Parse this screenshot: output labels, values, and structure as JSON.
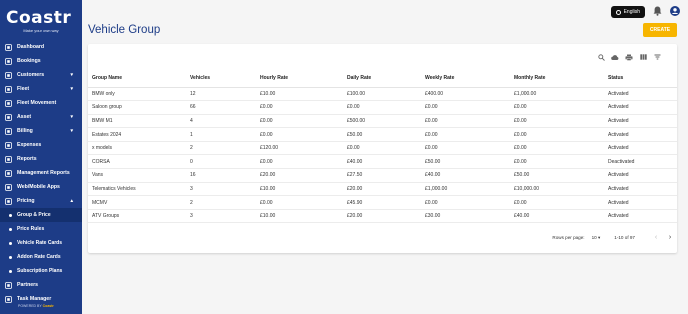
{
  "brand": {
    "name": "Coastr",
    "tagline": "Make your own way"
  },
  "topbar": {
    "language": "English"
  },
  "sidebar": {
    "items": [
      {
        "label": "Dashboard",
        "icon": "dashboard-icon"
      },
      {
        "label": "Bookings",
        "icon": "bookings-icon"
      },
      {
        "label": "Customers",
        "icon": "customers-icon",
        "expandable": true
      },
      {
        "label": "Fleet",
        "icon": "car-icon",
        "expandable": true
      },
      {
        "label": "Fleet Movement",
        "icon": "movement-icon"
      },
      {
        "label": "Asset",
        "icon": "asset-icon",
        "expandable": true
      },
      {
        "label": "Billing",
        "icon": "billing-icon",
        "expandable": true
      },
      {
        "label": "Expenses",
        "icon": "expenses-icon"
      },
      {
        "label": "Reports",
        "icon": "reports-icon"
      },
      {
        "label": "Management Reports",
        "icon": "mgmt-reports-icon"
      },
      {
        "label": "Web/Mobile Apps",
        "icon": "apps-icon"
      },
      {
        "label": "Pricing",
        "icon": "pricing-icon",
        "expandable": true,
        "open": true
      }
    ],
    "pricing_sub": [
      {
        "label": "Group & Price",
        "active": true
      },
      {
        "label": "Price Rules"
      },
      {
        "label": "Vehicle Rate Cards"
      },
      {
        "label": "Addon Rate Cards"
      },
      {
        "label": "Subscription Plans"
      }
    ],
    "after": [
      {
        "label": "Partners",
        "icon": "partners-icon"
      },
      {
        "label": "Task Manager",
        "icon": "task-icon"
      }
    ],
    "powered_prefix": "POWERED BY",
    "powered_brand": "Coastr"
  },
  "page": {
    "title": "Vehicle Group",
    "create_label": "CREATE"
  },
  "table": {
    "headers": [
      "Group Name",
      "Vehicles",
      "Hourly Rate",
      "Daily Rate",
      "Weekly Rate",
      "Monthly Rate",
      "Status"
    ],
    "rows": [
      [
        "BMW only",
        "12",
        "£10.00",
        "£100.00",
        "£400.00",
        "£1,000.00",
        "Activated"
      ],
      [
        "Saloon group",
        "66",
        "£0.00",
        "£0.00",
        "£0.00",
        "£0.00",
        "Activated"
      ],
      [
        "BMW M1",
        "4",
        "£0.00",
        "£500.00",
        "£0.00",
        "£0.00",
        "Activated"
      ],
      [
        "Estates 2024",
        "1",
        "£0.00",
        "£50.00",
        "£0.00",
        "£0.00",
        "Activated"
      ],
      [
        "x models",
        "2",
        "£120.00",
        "£0.00",
        "£0.00",
        "£0.00",
        "Activated"
      ],
      [
        "CORSA",
        "0",
        "£0.00",
        "£40.00",
        "£50.00",
        "£0.00",
        "Deactivated"
      ],
      [
        "Vans",
        "16",
        "£20.00",
        "£27.50",
        "£40.00",
        "£50.00",
        "Activated"
      ],
      [
        "Telematics Vehicles",
        "3",
        "£10.00",
        "£20.00",
        "£1,000.00",
        "£10,000.00",
        "Activated"
      ],
      [
        "MCMV",
        "2",
        "£0.00",
        "£45.90",
        "£0.00",
        "£0.00",
        "Activated"
      ],
      [
        "ATV Groups",
        "3",
        "£10.00",
        "£20.00",
        "£30.00",
        "£40.00",
        "Activated"
      ]
    ]
  },
  "pagination": {
    "rows_label": "Rows per page:",
    "rows_value": "10",
    "range": "1-10 of 97"
  }
}
